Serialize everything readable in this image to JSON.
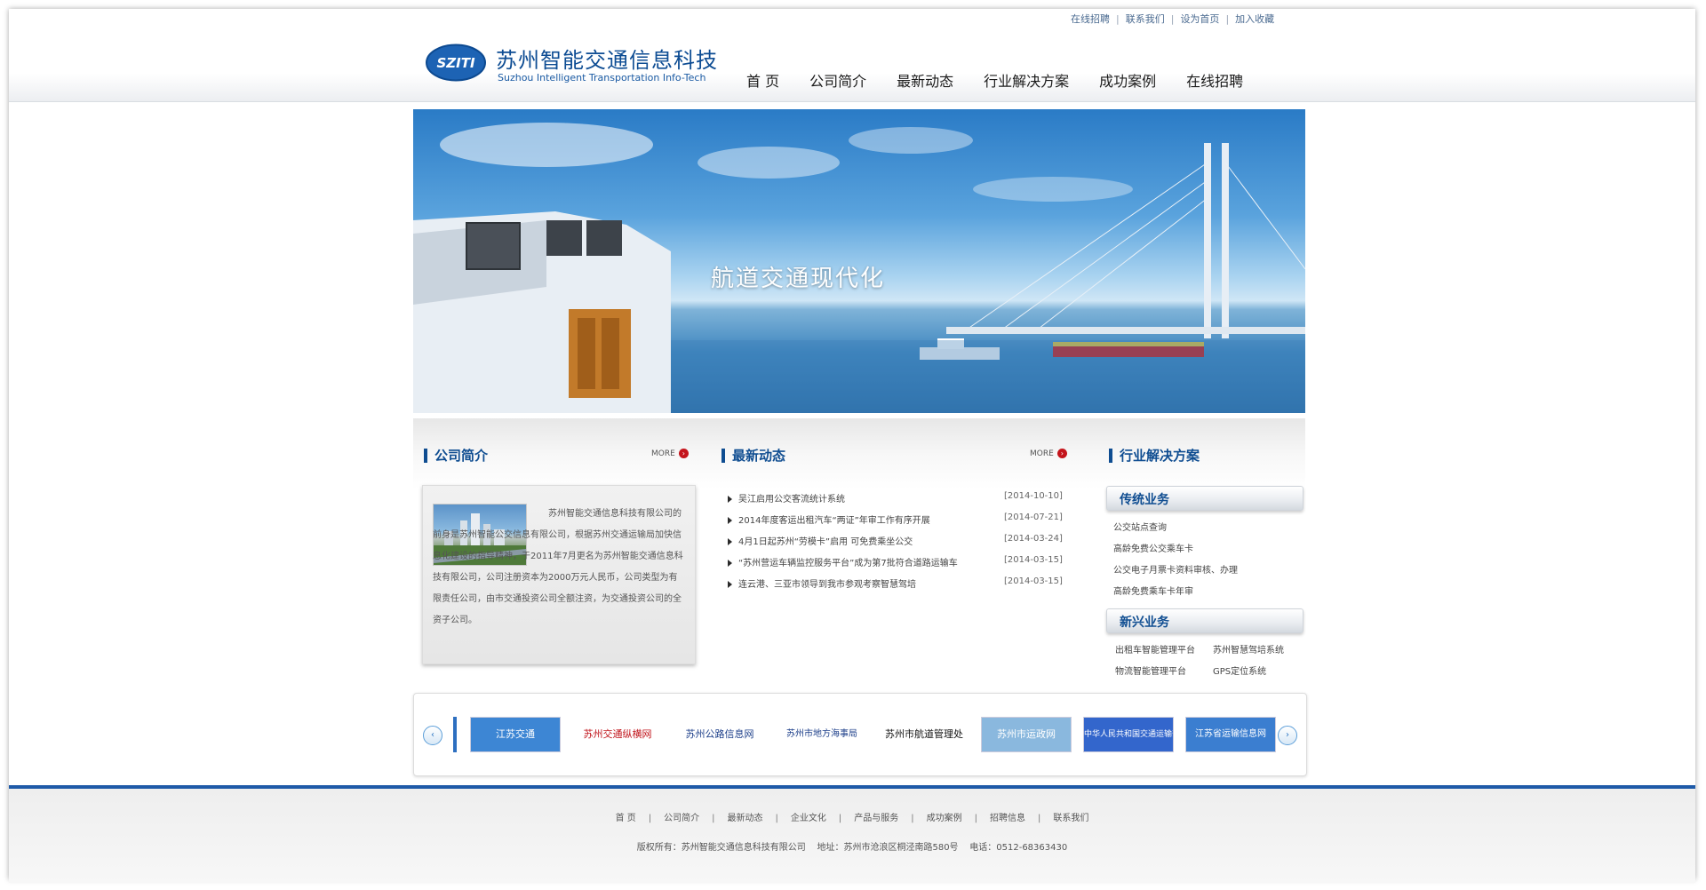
{
  "top_links": [
    "在线招聘",
    "联系我们",
    "设为首页",
    "加入收藏"
  ],
  "brand": {
    "logo_text": "SZITI",
    "name_cn": "苏州智能交通信息科技",
    "name_en": "Suzhou Intelligent Transportation Info-Tech"
  },
  "nav": [
    "首 页",
    "公司简介",
    "最新动态",
    "行业解决方案",
    "成功案例",
    "在线招聘"
  ],
  "banner": {
    "title": "航道交通现代化"
  },
  "about": {
    "title": "公司简介",
    "more": "MORE",
    "text": "苏州智能交通信息科技有限公司的前身是苏州智能公交信息有限公司，根据苏州交通运输局加快信息化建设的指导精神，于2011年7月更名为苏州智能交通信息科技有限公司，公司注册资本为2000万元人民币，公司类型为有限责任公司，由市交通投资公司全额注资，为交通投资公司的全资子公司。"
  },
  "news": {
    "title": "最新动态",
    "more": "MORE",
    "items": [
      {
        "title": "吴江启用公交客流统计系统",
        "date": "[2014-10-10]"
      },
      {
        "title": "2014年度客运出租汽车“两证”年审工作有序开展",
        "date": "[2014-07-21]"
      },
      {
        "title": "4月1日起苏州“劳模卡”启用 可免费乘坐公交",
        "date": "[2014-03-24]"
      },
      {
        "title": "“苏州营运车辆监控服务平台”成为第7批符合道路运输车",
        "date": "[2014-03-15]"
      },
      {
        "title": "连云港、三亚市领导到我市参观考察智慧驾培",
        "date": "[2014-03-15]"
      }
    ]
  },
  "solutions": {
    "title": "行业解决方案",
    "traditional": {
      "title": "传统业务",
      "items": [
        "公交站点查询",
        "高龄免费公交乘车卡",
        "公交电子月票卡资料审核、办理",
        "高龄免费乘车卡年审"
      ]
    },
    "emerging": {
      "title": "新兴业务",
      "items": [
        "出租车智能管理平台",
        "苏州智慧驾培系统",
        "物流智能管理平台",
        "GPS定位系统"
      ]
    }
  },
  "partners": {
    "prev": "‹",
    "next": "›",
    "logos": [
      "江苏交通",
      "苏州交通纵横网",
      "苏州公路信息网",
      "苏州市地方海事局",
      "苏州市航道管理处",
      "苏州市运政网",
      "中华人民共和国交通运输部",
      "江苏省运输信息网"
    ]
  },
  "footer": {
    "links": [
      "首 页",
      "公司简介",
      "最新动态",
      "企业文化",
      "产品与服务",
      "成功案例",
      "招聘信息",
      "联系我们"
    ],
    "copyright": "版权所有：苏州智能交通信息科技有限公司    地址：苏州市沧浪区桐泾南路580号    电话：0512-68363430"
  },
  "colors": {
    "brand_blue": "#0f4d91",
    "footer_bar": "#1e5aa8",
    "more_dot": "#c4141b"
  }
}
